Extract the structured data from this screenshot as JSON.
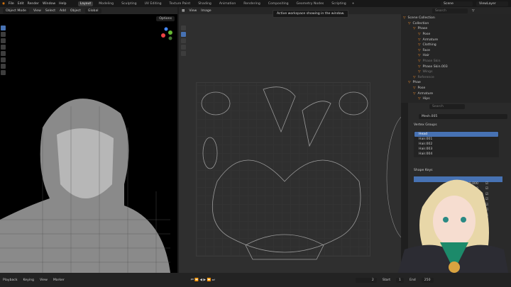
{
  "menu": [
    "File",
    "Edit",
    "Render",
    "Window",
    "Help"
  ],
  "workspaces": [
    "Layout",
    "Modeling",
    "Sculpting",
    "UV Editing",
    "Texture Paint",
    "Shading",
    "Animation",
    "Rendering",
    "Compositing",
    "Geometry Nodes",
    "Scripting"
  ],
  "active_workspace": "Layout",
  "scene": "Scene",
  "view_layer": "ViewLayer",
  "viewport_header": {
    "mode": "Object Mode",
    "items": [
      "View",
      "Select",
      "Add",
      "Object"
    ],
    "orientation": "Global",
    "options": "Options"
  },
  "uv_header": {
    "items": [
      "View",
      "Image"
    ]
  },
  "tooltip": "Active workspace showing in the window.",
  "outliner": {
    "search_placeholder": "Search",
    "rows": [
      {
        "label": "Scene Collection",
        "indent": 0
      },
      {
        "label": "Collection",
        "indent": 1
      },
      {
        "label": "Phase",
        "indent": 2
      },
      {
        "label": "Pose",
        "indent": 3
      },
      {
        "label": "Armature",
        "indent": 3
      },
      {
        "label": "Clothing",
        "indent": 3
      },
      {
        "label": "Face",
        "indent": 3
      },
      {
        "label": "Hair",
        "indent": 3
      },
      {
        "label": "Phase Skin",
        "indent": 3,
        "dim": true
      },
      {
        "label": "Phase Skin.003",
        "indent": 3
      },
      {
        "label": "Wings",
        "indent": 3,
        "dim": true
      },
      {
        "label": "Reference",
        "indent": 2,
        "dim": true
      },
      {
        "label": "Phae",
        "indent": 1
      },
      {
        "label": "Pose",
        "indent": 2
      },
      {
        "label": "Armature",
        "indent": 2
      },
      {
        "label": "Hips",
        "indent": 3
      }
    ]
  },
  "properties": {
    "search_placeholder": "Search",
    "mesh": "Mesh.005",
    "vertex_groups_title": "Vertex Groups",
    "vertex_groups": [
      "Head",
      "Hair.001",
      "Hair.002",
      "Hair.003",
      "Hair.004"
    ],
    "shape_keys_title": "Shape Keys",
    "shape_key_values": [
      "0.000",
      "0.000",
      "0.000",
      "0.000",
      "0.000",
      "0.000",
      "0.000",
      "0.000",
      "0.000",
      "0.000"
    ]
  },
  "timeline": {
    "items": [
      "Playback",
      "Keying",
      "View",
      "Marker"
    ],
    "frame": "2",
    "start_label": "Start",
    "start": "1",
    "end_label": "End",
    "end": "250"
  }
}
